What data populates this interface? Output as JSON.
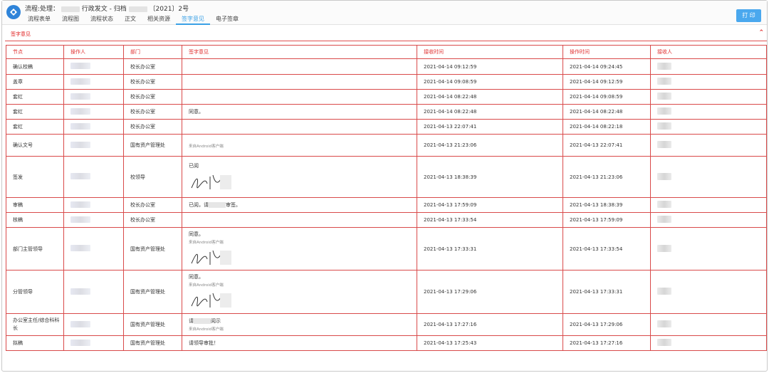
{
  "header": {
    "title_prefix": "流程:处理：",
    "title_mid1": "行政发文 - 归档",
    "title_mid2": "〔2021〕2号",
    "print_label": "打 印",
    "tabs": [
      "流程表单",
      "流程图",
      "流程状态",
      "正文",
      "相关资源",
      "签字意见",
      "电子签章"
    ],
    "active_tab": "签字意见"
  },
  "section": {
    "title": "签字意见",
    "collapse_icon": "double-chevron-up-icon"
  },
  "table": {
    "columns": [
      "节点",
      "操作人",
      "部门",
      "签字意见",
      "接收时间",
      "操作时间",
      "接收人"
    ],
    "rows": [
      {
        "node": "确认校稿",
        "dept": "校长办公室",
        "opinion": "",
        "sub": "",
        "recv": "2021-04-14 09:12:59",
        "op": "2021-04-14 09:24:45",
        "sign": false
      },
      {
        "node": "盖章",
        "dept": "校长办公室",
        "opinion": "",
        "sub": "",
        "recv": "2021-04-14 09:08:59",
        "op": "2021-04-14 09:12:59",
        "sign": false
      },
      {
        "node": "套红",
        "dept": "校长办公室",
        "opinion": "",
        "sub": "",
        "recv": "2021-04-14 08:22:48",
        "op": "2021-04-14 09:08:59",
        "sign": false
      },
      {
        "node": "套红",
        "dept": "校长办公室",
        "opinion": "同意。",
        "sub": "",
        "recv": "2021-04-14 08:22:48",
        "op": "2021-04-14 08:22:48",
        "sign": false
      },
      {
        "node": "套红",
        "dept": "校长办公室",
        "opinion": "",
        "sub": "",
        "recv": "2021-04-13 22:07:41",
        "op": "2021-04-14 08:22:18",
        "sign": false
      },
      {
        "node": "确认文号",
        "dept": "国有资产管理处",
        "opinion": "",
        "sub": "来自Android客户端",
        "recv": "2021-04-13 21:23:06",
        "op": "2021-04-13 22:07:41",
        "sign": false
      },
      {
        "node": "签发",
        "dept": "校领导",
        "opinion": "已阅",
        "sub": "",
        "recv": "2021-04-13 18:38:39",
        "op": "2021-04-13 21:23:06",
        "sign": true
      },
      {
        "node": "审稿",
        "dept": "校长办公室",
        "opinion": "已阅，请",
        "opinion_tail": "审签。",
        "sub": "",
        "recv": "2021-04-13 17:59:09",
        "op": "2021-04-13 18:38:39",
        "sign": false
      },
      {
        "node": "核稿",
        "dept": "校长办公室",
        "opinion": "",
        "sub": "",
        "recv": "2021-04-13 17:33:54",
        "op": "2021-04-13 17:59:09",
        "sign": false
      },
      {
        "node": "部门主管领导",
        "dept": "国有资产管理处",
        "opinion": "同意。",
        "sub": "来自Android客户端",
        "recv": "2021-04-13 17:33:31",
        "op": "2021-04-13 17:33:54",
        "sign": true
      },
      {
        "node": "分管领导",
        "dept": "国有资产管理处",
        "opinion": "同意。",
        "sub": "来自Android客户端",
        "recv": "2021-04-13 17:29:06",
        "op": "2021-04-13 17:33:31",
        "sign": true
      },
      {
        "node": "办公室主任/综合科科长",
        "dept": "国有资产管理处",
        "opinion": "请",
        "opinion_tail": "阅示",
        "sub": "来自Android客户端",
        "recv": "2021-04-13 17:27:16",
        "op": "2021-04-13 17:29:06",
        "sign": false
      },
      {
        "node": "拟稿",
        "dept": "国有资产管理处",
        "opinion": "请领导审批！",
        "sub": "",
        "recv": "2021-04-13 17:25:43",
        "op": "2021-04-13 17:27:16",
        "sign": false
      }
    ]
  },
  "colors": {
    "accent": "#3aa0e6",
    "border_red": "#d94a4a",
    "header_red": "#e03030",
    "print_button": "#4aa8ee",
    "logo": "#2f84d9"
  }
}
